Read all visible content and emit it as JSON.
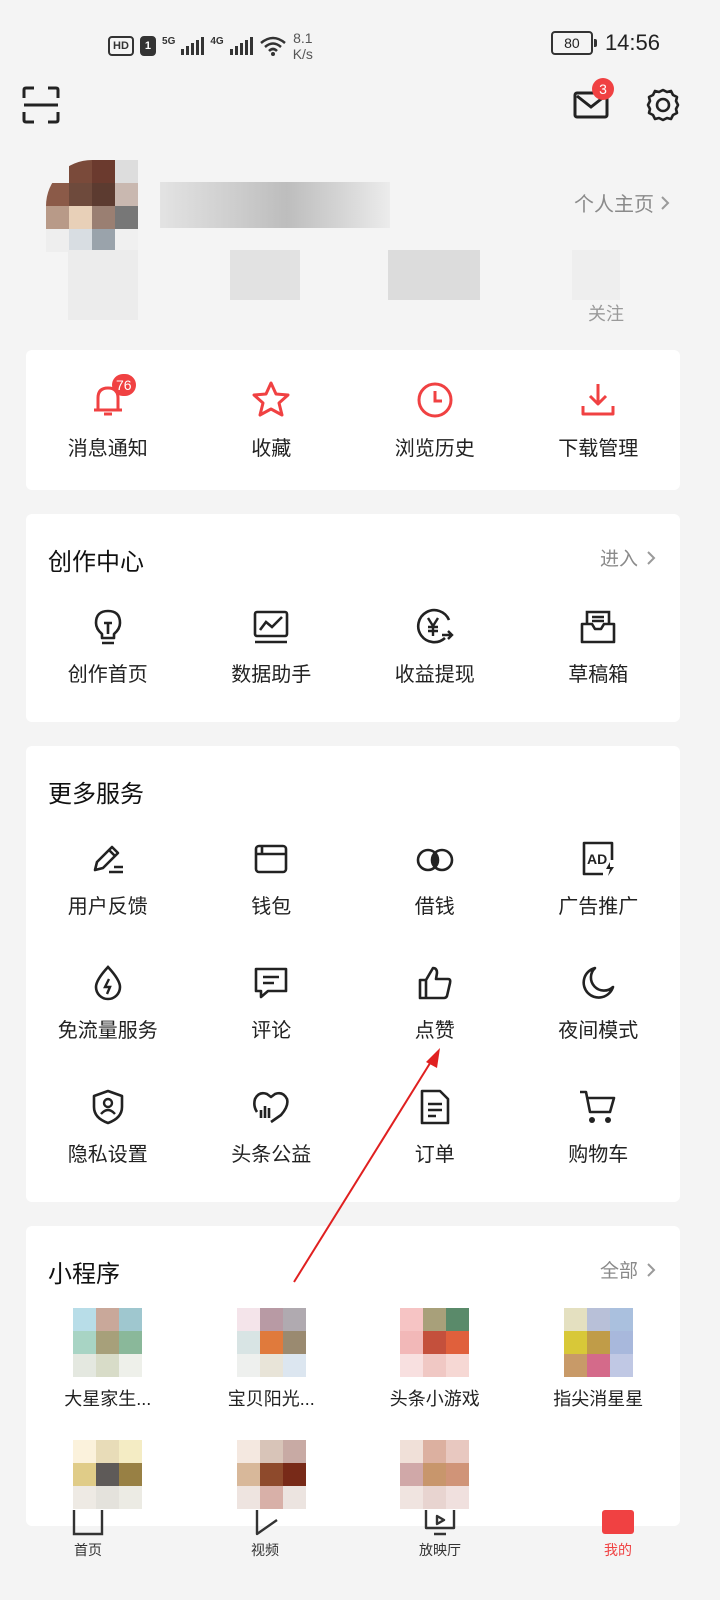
{
  "status_bar": {
    "hd": "HD",
    "sim": "1",
    "net1": "5G",
    "net2": "4G",
    "speed_value": "8.1",
    "speed_unit": "K/s",
    "battery": "80",
    "time": "14:56"
  },
  "header": {
    "scan_icon": "scan-icon",
    "mail_badge": "3",
    "settings_icon": "gear-icon"
  },
  "profile": {
    "home_link": "个人主页",
    "follow_label_partial": "关注"
  },
  "quick_actions": [
    {
      "label": "消息通知",
      "icon": "bell-icon",
      "badge": "76"
    },
    {
      "label": "收藏",
      "icon": "star-icon"
    },
    {
      "label": "浏览历史",
      "icon": "clock-icon"
    },
    {
      "label": "下载管理",
      "icon": "download-icon"
    }
  ],
  "creation_center": {
    "title": "创作中心",
    "more": "进入",
    "items": [
      {
        "label": "创作首页",
        "icon": "lightbulb-icon"
      },
      {
        "label": "数据助手",
        "icon": "chart-icon"
      },
      {
        "label": "收益提现",
        "icon": "yuan-icon"
      },
      {
        "label": "草稿箱",
        "icon": "drafts-icon"
      }
    ]
  },
  "more_services": {
    "title": "更多服务",
    "items": [
      {
        "label": "用户反馈",
        "icon": "pen-icon"
      },
      {
        "label": "钱包",
        "icon": "wallet-icon"
      },
      {
        "label": "借钱",
        "icon": "loan-icon"
      },
      {
        "label": "广告推广",
        "icon": "ad-icon"
      },
      {
        "label": "免流量服务",
        "icon": "water-drop-icon"
      },
      {
        "label": "评论",
        "icon": "comment-icon"
      },
      {
        "label": "点赞",
        "icon": "thumbs-up-icon"
      },
      {
        "label": "夜间模式",
        "icon": "moon-icon"
      },
      {
        "label": "隐私设置",
        "icon": "shield-user-icon"
      },
      {
        "label": "头条公益",
        "icon": "charity-icon"
      },
      {
        "label": "订单",
        "icon": "order-icon"
      },
      {
        "label": "购物车",
        "icon": "cart-icon"
      }
    ]
  },
  "mini_programs": {
    "title": "小程序",
    "more": "全部",
    "items": [
      {
        "label": "大星家生..."
      },
      {
        "label": "宝贝阳光..."
      },
      {
        "label": "头条小游戏"
      },
      {
        "label": "指尖消星星"
      }
    ]
  },
  "bottom_nav": [
    {
      "label": "首页",
      "icon": "home-icon"
    },
    {
      "label": "视频",
      "icon": "video-icon"
    },
    {
      "label": "放映厅",
      "icon": "theater-icon"
    },
    {
      "label": "我的",
      "icon": "me-icon",
      "active": true
    }
  ],
  "colors": {
    "accent": "#f04142",
    "background": "#f4f4f4",
    "card": "#ffffff",
    "muted": "#8a8a8a"
  }
}
